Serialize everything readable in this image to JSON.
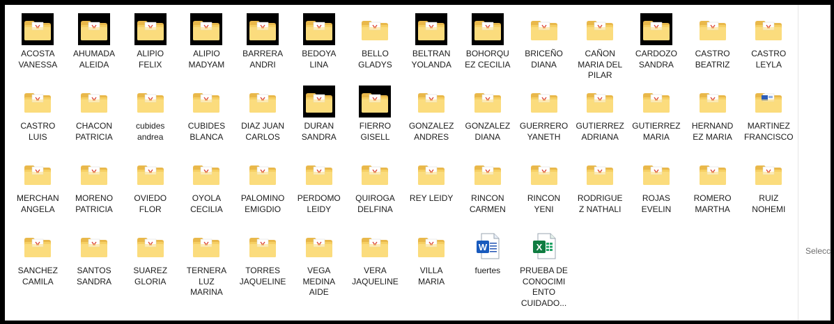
{
  "explorer": {
    "side_text": "Selecci",
    "items": [
      {
        "label": "ACOSTA\nVANESSA",
        "icon": "folder-pdf-icon",
        "dark": true
      },
      {
        "label": "AHUMADA\nALEIDA",
        "icon": "folder-pdf-icon",
        "dark": true
      },
      {
        "label": "ALIPIO\nFELIX",
        "icon": "folder-pdf-icon",
        "dark": true
      },
      {
        "label": "ALIPIO\nMADYAM",
        "icon": "folder-pdf-icon",
        "dark": true
      },
      {
        "label": "BARRERA\nANDRI",
        "icon": "folder-pdf-icon",
        "dark": true
      },
      {
        "label": "BEDOYA\nLINA",
        "icon": "folder-pdf-icon",
        "dark": true
      },
      {
        "label": "BELLO\nGLADYS",
        "icon": "folder-pdf-icon",
        "dark": false
      },
      {
        "label": "BELTRAN\nYOLANDA",
        "icon": "folder-pdf-icon",
        "dark": true
      },
      {
        "label": "BOHORQU\nEZ CECILIA",
        "icon": "folder-pdf-icon",
        "dark": true
      },
      {
        "label": "BRICEÑO\nDIANA",
        "icon": "folder-pdf-icon",
        "dark": false
      },
      {
        "label": "CAÑON\nMARIA DEL\nPILAR",
        "icon": "folder-pdf-icon",
        "dark": false
      },
      {
        "label": "CARDOZO\nSANDRA",
        "icon": "folder-pdf-icon",
        "dark": true
      },
      {
        "label": "CASTRO\nBEATRIZ",
        "icon": "folder-pdf-icon",
        "dark": false
      },
      {
        "label": "CASTRO\nLEYLA",
        "icon": "folder-pdf-icon",
        "dark": false
      },
      {
        "label": "CASTRO\nLUIS",
        "icon": "folder-pdf-icon",
        "dark": false
      },
      {
        "label": "CHACON\nPATRICIA",
        "icon": "folder-pdf-icon",
        "dark": false
      },
      {
        "label": "cubides\nandrea",
        "icon": "folder-pdf-icon",
        "dark": false
      },
      {
        "label": "CUBIDES\nBLANCA",
        "icon": "folder-pdf-icon",
        "dark": false
      },
      {
        "label": "DIAZ JUAN\nCARLOS",
        "icon": "folder-pdf-icon",
        "dark": false
      },
      {
        "label": "DURAN\nSANDRA",
        "icon": "folder-pdf-icon",
        "dark": true
      },
      {
        "label": "FIERRO\nGISELL",
        "icon": "folder-pdf-icon",
        "dark": true
      },
      {
        "label": "GONZALEZ\nANDRES",
        "icon": "folder-pdf-icon",
        "dark": false
      },
      {
        "label": "GONZALEZ\nDIANA",
        "icon": "folder-pdf-icon",
        "dark": false
      },
      {
        "label": "GUERRERO\nYANETH",
        "icon": "folder-pdf-icon",
        "dark": false
      },
      {
        "label": "GUTIERREZ\nADRIANA",
        "icon": "folder-pdf-icon",
        "dark": false
      },
      {
        "label": "GUTIERREZ\nMARIA",
        "icon": "folder-pdf-icon",
        "dark": false
      },
      {
        "label": "HERNAND\nEZ MARIA",
        "icon": "folder-pdf-icon",
        "dark": false
      },
      {
        "label": "MARTINEZ\nFRANCISCO",
        "icon": "folder-word-icon",
        "dark": false
      },
      {
        "label": "MERCHAN\nANGELA",
        "icon": "folder-pdf-icon",
        "dark": false
      },
      {
        "label": "MORENO\nPATRICIA",
        "icon": "folder-pdf-icon",
        "dark": false
      },
      {
        "label": "OVIEDO\nFLOR",
        "icon": "folder-pdf-icon",
        "dark": false
      },
      {
        "label": "OYOLA\nCECILIA",
        "icon": "folder-pdf-icon",
        "dark": false
      },
      {
        "label": "PALOMINO\nEMIGDIO",
        "icon": "folder-pdf-icon",
        "dark": false
      },
      {
        "label": "PERDOMO\nLEIDY",
        "icon": "folder-pdf-icon",
        "dark": false
      },
      {
        "label": "QUIROGA\nDELFINA",
        "icon": "folder-pdf-icon",
        "dark": false
      },
      {
        "label": "REY LEIDY",
        "icon": "folder-pdf-icon",
        "dark": false
      },
      {
        "label": "RINCON\nCARMEN",
        "icon": "folder-pdf-icon",
        "dark": false
      },
      {
        "label": "RINCON\nYENI",
        "icon": "folder-pdf-icon",
        "dark": false
      },
      {
        "label": "RODRIGUE\nZ NATHALI",
        "icon": "folder-pdf-icon",
        "dark": false
      },
      {
        "label": "ROJAS\nEVELIN",
        "icon": "folder-pdf-icon",
        "dark": false
      },
      {
        "label": "ROMERO\nMARTHA",
        "icon": "folder-pdf-icon",
        "dark": false
      },
      {
        "label": "RUIZ\nNOHEMI",
        "icon": "folder-pdf-icon",
        "dark": false
      },
      {
        "label": "SANCHEZ\nCAMILA",
        "icon": "folder-pdf-icon",
        "dark": false
      },
      {
        "label": "SANTOS\nSANDRA",
        "icon": "folder-pdf-icon",
        "dark": false
      },
      {
        "label": "SUAREZ\nGLORIA",
        "icon": "folder-pdf-icon",
        "dark": false
      },
      {
        "label": "TERNERA\nLUZ\nMARINA",
        "icon": "folder-pdf-icon",
        "dark": false
      },
      {
        "label": "TORRES\nJAQUELINE",
        "icon": "folder-pdf-icon",
        "dark": false
      },
      {
        "label": "VEGA\nMEDINA\nAIDE",
        "icon": "folder-pdf-icon",
        "dark": false
      },
      {
        "label": "VERA\nJAQUELINE",
        "icon": "folder-pdf-icon",
        "dark": false
      },
      {
        "label": "VILLA\nMARIA",
        "icon": "folder-pdf-icon",
        "dark": false
      },
      {
        "label": "fuertes",
        "icon": "word-doc-icon",
        "dark": false
      },
      {
        "label": "PRUEBA DE\nCONOCIMI\nENTO\nCUIDADO...",
        "icon": "excel-doc-icon",
        "dark": false
      }
    ]
  }
}
